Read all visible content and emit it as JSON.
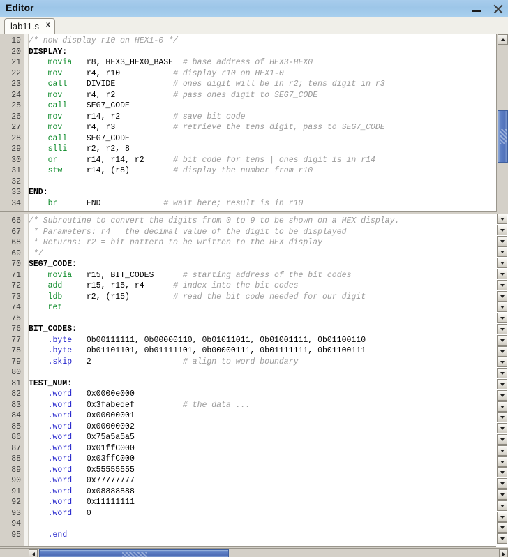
{
  "window": {
    "title": "Editor",
    "minimize_label": "–",
    "close_label": "×"
  },
  "tabs": [
    {
      "label": "lab11.s",
      "close_label": "x",
      "active": true
    }
  ],
  "colors": {
    "titlebar": "#a8ccec",
    "gutter": "#d4d0c8",
    "code_bg": "#ffffff",
    "mnemonic": "#0b8a28",
    "directive": "#2222cc",
    "comment": "#9b9b9b",
    "label": "#000000",
    "scrollbar_thumb": "#5d7fc4"
  },
  "panes": [
    {
      "name": "top-pane",
      "lines": [
        {
          "n": "19",
          "segments": [
            {
              "t": "/* now display r10 on HEX1-0 */",
              "c": "com"
            }
          ]
        },
        {
          "n": "20",
          "segments": [
            {
              "t": "DISPLAY:",
              "c": "label"
            }
          ]
        },
        {
          "n": "21",
          "segments": [
            {
              "t": "    ",
              "c": "txt"
            },
            {
              "t": "movia",
              "c": "mnem"
            },
            {
              "t": "   r8, HEX3_HEX0_BASE  ",
              "c": "lbl"
            },
            {
              "t": "# base address of HEX3-HEX0",
              "c": "com"
            }
          ]
        },
        {
          "n": "22",
          "segments": [
            {
              "t": "    ",
              "c": "txt"
            },
            {
              "t": "mov",
              "c": "mnem"
            },
            {
              "t": "     r4, r10           ",
              "c": "lbl"
            },
            {
              "t": "# display r10 on HEX1-0",
              "c": "com"
            }
          ]
        },
        {
          "n": "23",
          "segments": [
            {
              "t": "    ",
              "c": "txt"
            },
            {
              "t": "call",
              "c": "mnem"
            },
            {
              "t": "    DIVIDE            ",
              "c": "lbl"
            },
            {
              "t": "# ones digit will be in r2; tens digit in r3",
              "c": "com"
            }
          ]
        },
        {
          "n": "24",
          "segments": [
            {
              "t": "    ",
              "c": "txt"
            },
            {
              "t": "mov",
              "c": "mnem"
            },
            {
              "t": "     r4, r2            ",
              "c": "lbl"
            },
            {
              "t": "# pass ones digit to SEG7_CODE",
              "c": "com"
            }
          ]
        },
        {
          "n": "25",
          "segments": [
            {
              "t": "    ",
              "c": "txt"
            },
            {
              "t": "call",
              "c": "mnem"
            },
            {
              "t": "    SEG7_CODE",
              "c": "lbl"
            }
          ]
        },
        {
          "n": "26",
          "segments": [
            {
              "t": "    ",
              "c": "txt"
            },
            {
              "t": "mov",
              "c": "mnem"
            },
            {
              "t": "     r14, r2           ",
              "c": "lbl"
            },
            {
              "t": "# save bit code",
              "c": "com"
            }
          ]
        },
        {
          "n": "27",
          "segments": [
            {
              "t": "    ",
              "c": "txt"
            },
            {
              "t": "mov",
              "c": "mnem"
            },
            {
              "t": "     r4, r3            ",
              "c": "lbl"
            },
            {
              "t": "# retrieve the tens digit, pass to SEG7_CODE",
              "c": "com"
            }
          ]
        },
        {
          "n": "28",
          "segments": [
            {
              "t": "    ",
              "c": "txt"
            },
            {
              "t": "call",
              "c": "mnem"
            },
            {
              "t": "    SEG7_CODE",
              "c": "lbl"
            }
          ]
        },
        {
          "n": "29",
          "segments": [
            {
              "t": "    ",
              "c": "txt"
            },
            {
              "t": "slli",
              "c": "mnem"
            },
            {
              "t": "    r2, r2, 8",
              "c": "lbl"
            }
          ]
        },
        {
          "n": "30",
          "segments": [
            {
              "t": "    ",
              "c": "txt"
            },
            {
              "t": "or",
              "c": "mnem"
            },
            {
              "t": "      r14, r14, r2      ",
              "c": "lbl"
            },
            {
              "t": "# bit code for tens | ones digit is in r14",
              "c": "com"
            }
          ]
        },
        {
          "n": "31",
          "segments": [
            {
              "t": "    ",
              "c": "txt"
            },
            {
              "t": "stw",
              "c": "mnem"
            },
            {
              "t": "     r14, (r8)         ",
              "c": "lbl"
            },
            {
              "t": "# display the number from r10",
              "c": "com"
            }
          ]
        },
        {
          "n": "32",
          "segments": []
        },
        {
          "n": "33",
          "segments": [
            {
              "t": "END:",
              "c": "label"
            }
          ]
        },
        {
          "n": "34",
          "segments": [
            {
              "t": "    ",
              "c": "txt"
            },
            {
              "t": "br",
              "c": "mnem"
            },
            {
              "t": "      END             ",
              "c": "lbl"
            },
            {
              "t": "# wait here; result is in r10",
              "c": "com"
            }
          ]
        }
      ]
    },
    {
      "name": "bottom-pane",
      "lines": [
        {
          "n": "66",
          "segments": [
            {
              "t": "/* Subroutine to convert the digits from 0 to 9 to be shown on a HEX display.",
              "c": "com"
            }
          ]
        },
        {
          "n": "67",
          "segments": [
            {
              "t": " * Parameters: r4 = the decimal value of the digit to be displayed",
              "c": "com"
            }
          ]
        },
        {
          "n": "68",
          "segments": [
            {
              "t": " * Returns: r2 = bit pattern to be written to the HEX display",
              "c": "com"
            }
          ]
        },
        {
          "n": "69",
          "segments": [
            {
              "t": " */",
              "c": "com"
            }
          ]
        },
        {
          "n": "70",
          "segments": [
            {
              "t": "SEG7_CODE:",
              "c": "label"
            }
          ]
        },
        {
          "n": "71",
          "segments": [
            {
              "t": "    ",
              "c": "txt"
            },
            {
              "t": "movia",
              "c": "mnem"
            },
            {
              "t": "   r15, BIT_CODES      ",
              "c": "lbl"
            },
            {
              "t": "# starting address of the bit codes",
              "c": "com"
            }
          ]
        },
        {
          "n": "72",
          "segments": [
            {
              "t": "    ",
              "c": "txt"
            },
            {
              "t": "add",
              "c": "mnem"
            },
            {
              "t": "     r15, r15, r4      ",
              "c": "lbl"
            },
            {
              "t": "# index into the bit codes",
              "c": "com"
            }
          ]
        },
        {
          "n": "73",
          "segments": [
            {
              "t": "    ",
              "c": "txt"
            },
            {
              "t": "ldb",
              "c": "mnem"
            },
            {
              "t": "     r2, (r15)         ",
              "c": "lbl"
            },
            {
              "t": "# read the bit code needed for our digit",
              "c": "com"
            }
          ]
        },
        {
          "n": "74",
          "segments": [
            {
              "t": "    ",
              "c": "txt"
            },
            {
              "t": "ret",
              "c": "mnem"
            }
          ]
        },
        {
          "n": "75",
          "segments": []
        },
        {
          "n": "76",
          "segments": [
            {
              "t": "BIT_CODES:",
              "c": "label"
            }
          ]
        },
        {
          "n": "77",
          "segments": [
            {
              "t": "    ",
              "c": "txt"
            },
            {
              "t": ".byte",
              "c": "dir"
            },
            {
              "t": "   0b00111111, 0b00000110, 0b01011011, 0b01001111, 0b01100110",
              "c": "lbl"
            }
          ]
        },
        {
          "n": "78",
          "segments": [
            {
              "t": "    ",
              "c": "txt"
            },
            {
              "t": ".byte",
              "c": "dir"
            },
            {
              "t": "   0b01101101, 0b01111101, 0b00000111, 0b01111111, 0b01100111",
              "c": "lbl"
            }
          ]
        },
        {
          "n": "79",
          "segments": [
            {
              "t": "    ",
              "c": "txt"
            },
            {
              "t": ".skip",
              "c": "dir"
            },
            {
              "t": "   2                   ",
              "c": "lbl"
            },
            {
              "t": "# align to word boundary",
              "c": "com"
            }
          ]
        },
        {
          "n": "80",
          "segments": []
        },
        {
          "n": "81",
          "segments": [
            {
              "t": "TEST_NUM:",
              "c": "label"
            }
          ]
        },
        {
          "n": "82",
          "segments": [
            {
              "t": "    ",
              "c": "txt"
            },
            {
              "t": ".word",
              "c": "dir"
            },
            {
              "t": "   0x0000e000",
              "c": "lbl"
            }
          ]
        },
        {
          "n": "83",
          "segments": [
            {
              "t": "    ",
              "c": "txt"
            },
            {
              "t": ".word",
              "c": "dir"
            },
            {
              "t": "   0x3fabedef          ",
              "c": "lbl"
            },
            {
              "t": "# the data ...",
              "c": "com"
            }
          ]
        },
        {
          "n": "84",
          "segments": [
            {
              "t": "    ",
              "c": "txt"
            },
            {
              "t": ".word",
              "c": "dir"
            },
            {
              "t": "   0x00000001",
              "c": "lbl"
            }
          ]
        },
        {
          "n": "85",
          "segments": [
            {
              "t": "    ",
              "c": "txt"
            },
            {
              "t": ".word",
              "c": "dir"
            },
            {
              "t": "   0x00000002",
              "c": "lbl"
            }
          ]
        },
        {
          "n": "86",
          "segments": [
            {
              "t": "    ",
              "c": "txt"
            },
            {
              "t": ".word",
              "c": "dir"
            },
            {
              "t": "   0x75a5a5a5",
              "c": "lbl"
            }
          ]
        },
        {
          "n": "87",
          "segments": [
            {
              "t": "    ",
              "c": "txt"
            },
            {
              "t": ".word",
              "c": "dir"
            },
            {
              "t": "   0x01ffC000",
              "c": "lbl"
            }
          ]
        },
        {
          "n": "88",
          "segments": [
            {
              "t": "    ",
              "c": "txt"
            },
            {
              "t": ".word",
              "c": "dir"
            },
            {
              "t": "   0x03ffC000",
              "c": "lbl"
            }
          ]
        },
        {
          "n": "89",
          "segments": [
            {
              "t": "    ",
              "c": "txt"
            },
            {
              "t": ".word",
              "c": "dir"
            },
            {
              "t": "   0x55555555",
              "c": "lbl"
            }
          ]
        },
        {
          "n": "90",
          "segments": [
            {
              "t": "    ",
              "c": "txt"
            },
            {
              "t": ".word",
              "c": "dir"
            },
            {
              "t": "   0x77777777",
              "c": "lbl"
            }
          ]
        },
        {
          "n": "91",
          "segments": [
            {
              "t": "    ",
              "c": "txt"
            },
            {
              "t": ".word",
              "c": "dir"
            },
            {
              "t": "   0x08888888",
              "c": "lbl"
            }
          ]
        },
        {
          "n": "92",
          "segments": [
            {
              "t": "    ",
              "c": "txt"
            },
            {
              "t": ".word",
              "c": "dir"
            },
            {
              "t": "   0x11111111",
              "c": "lbl"
            }
          ]
        },
        {
          "n": "93",
          "segments": [
            {
              "t": "    ",
              "c": "txt"
            },
            {
              "t": ".word",
              "c": "dir"
            },
            {
              "t": "   0",
              "c": "lbl"
            }
          ]
        },
        {
          "n": "94",
          "segments": []
        },
        {
          "n": "95",
          "segments": [
            {
              "t": "    ",
              "c": "txt"
            },
            {
              "t": ".end",
              "c": "dir"
            }
          ]
        }
      ]
    }
  ],
  "scrollbars": {
    "vertical": {
      "up_icon": "triangle-up",
      "down_icon": "triangle-down"
    },
    "horizontal": {
      "left_icon": "triangle-left",
      "right_icon": "triangle-right"
    },
    "stack_button_icon": "triangle-down",
    "stack_button_count": 30
  }
}
